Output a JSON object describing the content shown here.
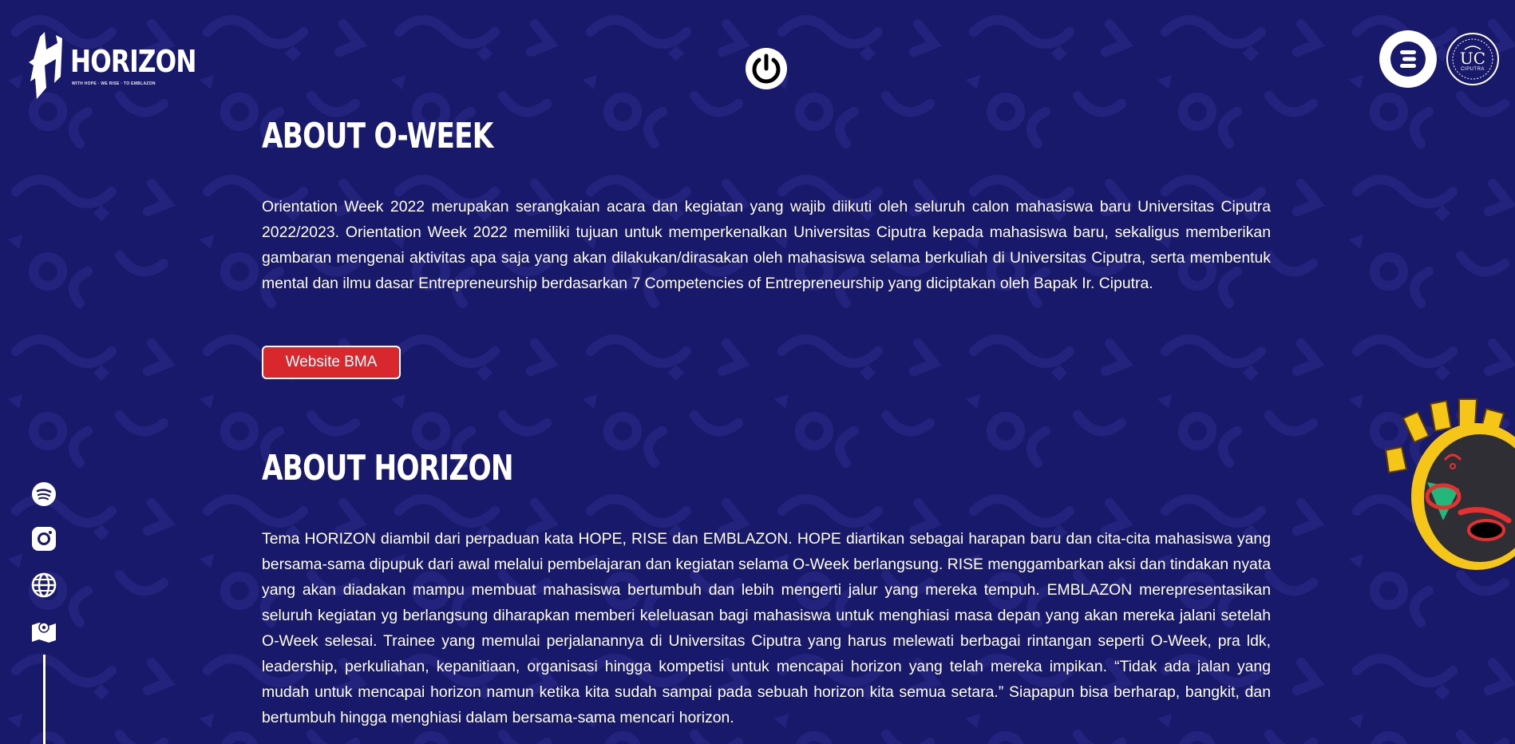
{
  "header": {
    "logo_text": "HORIZON",
    "logo_tagline": "WITH HOPE · WE RISE · TO EMBLAZON",
    "power_icon": "power-icon",
    "partner_logos": [
      "o-week-logo",
      "universitas-ciputra-seal"
    ],
    "uc_seal_text": "UC",
    "uc_seal_subtext": "CIPUTRA"
  },
  "about_oweek": {
    "title": "ABOUT O-WEEK",
    "text": "Orientation Week 2022 merupakan serangkaian acara dan kegiatan yang wajib diikuti oleh seluruh calon mahasiswa baru Universitas Ciputra 2022/2023. Orientation Week 2022 memiliki tujuan untuk memperkenalkan Universitas Ciputra kepada mahasiswa baru, sekaligus memberikan gambaran mengenai aktivitas apa saja yang akan dilakukan/dirasakan oleh mahasiswa selama berkuliah di Universitas Ciputra, serta membentuk mental dan ilmu dasar Entrepreneurship berdasarkan 7 Competencies of Entrepreneurship yang diciptakan oleh Bapak Ir. Ciputra.",
    "button_label": "Website BMA"
  },
  "about_horizon": {
    "title": "ABOUT HORIZON",
    "text": "Tema HORIZON diambil dari perpaduan kata HOPE, RISE dan EMBLAZON. HOPE diartikan sebagai harapan baru dan cita-cita mahasiswa yang bersama-sama dipupuk dari awal melalui pembelajaran dan kegiatan selama O-Week berlangsung. RISE menggambarkan aksi dan tindakan nyata yang akan diadakan mampu membuat mahasiswa bertumbuh dan lebih mengerti jalur yang mereka tempuh. EMBLAZON merepresentasikan seluruh kegiatan yg berlangsung diharapkan memberi keleluasan bagi mahasiswa untuk menghiasi masa depan yang akan mereka jalani setelah O-Week selesai. Trainee yang memulai perjalanannya di Universitas Ciputra yang harus melewati berbagai rintangan seperti O-Week, pra ldk, leadership, perkuliahan, kepanitiaan, organisasi hingga kompetisi untuk mencapai horizon yang telah mereka impikan. “Tidak ada jalan yang mudah untuk mencapai horizon namun ketika kita sudah sampai pada sebuah horizon kita semua setara.” Siapapun bisa berharap, bangkit, dan bertumbuh hingga menghiasi dalam bersama-sama mencari horizon."
  },
  "social_links": [
    "spotify-icon",
    "instagram-icon",
    "globe-icon",
    "map-icon"
  ],
  "colors": {
    "background": "#19196b",
    "pattern": "#23237d",
    "button_red": "#d9272e",
    "mask_yellow": "#f5c518"
  }
}
